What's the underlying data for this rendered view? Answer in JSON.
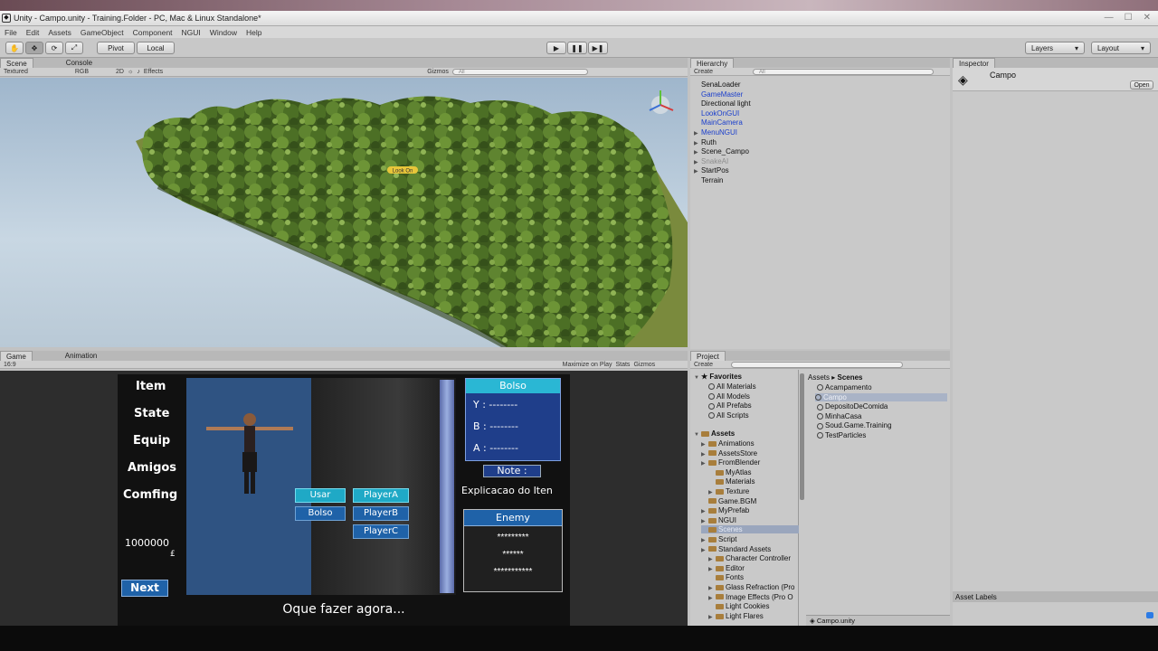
{
  "window": {
    "title": "Unity - Campo.unity - Training.Folder - PC, Mac & Linux Standalone*"
  },
  "menu": [
    "File",
    "Edit",
    "Assets",
    "GameObject",
    "Component",
    "NGUI",
    "Window",
    "Help"
  ],
  "toolbar": {
    "pivot": "Pivot",
    "local": "Local",
    "layers": "Layers",
    "layout": "Layout"
  },
  "scene": {
    "tab": "Scene",
    "console_tab": "Console",
    "shading": "Textured",
    "rgb": "RGB",
    "mode2d": "2D",
    "effects": "Effects",
    "gizmos": "Gizmos",
    "search": "All",
    "marker": "Look On"
  },
  "hierarchy": {
    "tab": "Hierarchy",
    "create": "Create",
    "search": "All",
    "items": [
      {
        "label": "SenaLoader",
        "color": "#111",
        "arrow": false
      },
      {
        "label": "GameMaster",
        "color": "#1b3fcc",
        "arrow": false
      },
      {
        "label": "Directional light",
        "color": "#111",
        "arrow": false
      },
      {
        "label": "LookOnGUI",
        "color": "#1b3fcc",
        "arrow": false
      },
      {
        "label": "MainCamera",
        "color": "#1b3fcc",
        "arrow": false
      },
      {
        "label": "MenuNGUI",
        "color": "#1b3fcc",
        "arrow": true
      },
      {
        "label": "Ruth",
        "color": "#111",
        "arrow": true
      },
      {
        "label": "Scene_Campo",
        "color": "#111",
        "arrow": true
      },
      {
        "label": "SnakeAI",
        "color": "#8c8c8c",
        "arrow": true
      },
      {
        "label": "StartPos",
        "color": "#111",
        "arrow": true
      },
      {
        "label": "Terrain",
        "color": "#111",
        "arrow": false
      }
    ]
  },
  "inspector": {
    "tab": "Inspector",
    "object": "Campo",
    "open": "Open",
    "asset_labels": "Asset Labels"
  },
  "game": {
    "tab": "Game",
    "animation_tab": "Animation",
    "aspect": "16:9",
    "maximize": "Maximize on Play",
    "stats": "Stats",
    "gizmos": "Gizmos",
    "menu": [
      "Item",
      "State",
      "Equip",
      "Amigos",
      "Comfing"
    ],
    "money": "1000000",
    "money_unit": "£",
    "next": "Next",
    "bolso_title": "Bolso",
    "slots": [
      "Y : --------",
      "B : --------",
      "A : --------"
    ],
    "note": "Note :",
    "explanation": "Explicacao do Iten",
    "actions": [
      "Usar",
      "Bolso"
    ],
    "players": [
      "PlayerA",
      "PlayerB",
      "PlayerC"
    ],
    "enemy": "Enemy",
    "stars": [
      "*********",
      "******",
      "***********"
    ],
    "prompt": "Oque fazer agora..."
  },
  "project": {
    "tab": "Project",
    "create": "Create",
    "favorites": "Favorites",
    "fav_items": [
      "All Materials",
      "All Models",
      "All Prefabs",
      "All Scripts"
    ],
    "assets_label": "Assets",
    "tree": [
      {
        "label": "Animations",
        "indent": 1,
        "arrow": true
      },
      {
        "label": "AssetsStore",
        "indent": 1,
        "arrow": true
      },
      {
        "label": "FromBlender",
        "indent": 1,
        "arrow": true
      },
      {
        "label": "MyAtlas",
        "indent": 2,
        "arrow": false
      },
      {
        "label": "Materials",
        "indent": 2,
        "arrow": false
      },
      {
        "label": "Texture",
        "indent": 2,
        "arrow": true
      },
      {
        "label": "Game.BGM",
        "indent": 1,
        "arrow": false
      },
      {
        "label": "MyPrefab",
        "indent": 1,
        "arrow": true
      },
      {
        "label": "NGUI",
        "indent": 1,
        "arrow": true
      },
      {
        "label": "Scenes",
        "indent": 1,
        "arrow": false,
        "selected": true
      },
      {
        "label": "Script",
        "indent": 1,
        "arrow": true
      },
      {
        "label": "Standard Assets",
        "indent": 1,
        "arrow": true
      },
      {
        "label": "Character Controller",
        "indent": 2,
        "arrow": true
      },
      {
        "label": "Editor",
        "indent": 2,
        "arrow": true
      },
      {
        "label": "Fonts",
        "indent": 2,
        "arrow": false
      },
      {
        "label": "Glass Refraction (Pro",
        "indent": 2,
        "arrow": true
      },
      {
        "label": "Image Effects (Pro O",
        "indent": 2,
        "arrow": true
      },
      {
        "label": "Light Cookies",
        "indent": 2,
        "arrow": false
      },
      {
        "label": "Light Flares",
        "indent": 2,
        "arrow": true
      }
    ],
    "breadcrumb": [
      "Assets",
      "Scenes"
    ],
    "files": [
      {
        "label": "Acampamento",
        "selected": false
      },
      {
        "label": "Campo",
        "selected": true
      },
      {
        "label": "DepositoDeComida",
        "selected": false
      },
      {
        "label": "MinhaCasa",
        "selected": false
      },
      {
        "label": "Soud.Game.Training",
        "selected": false
      },
      {
        "label": "TestParticles",
        "selected": false
      }
    ],
    "footer": "Campo.unity"
  }
}
